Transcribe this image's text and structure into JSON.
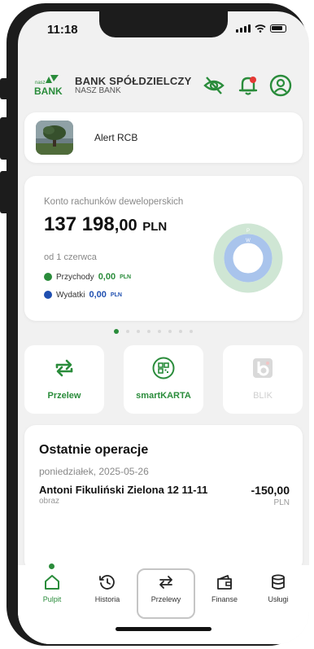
{
  "status": {
    "time": "11:18"
  },
  "header": {
    "bank_name": "BANK SPÓŁDZIELCZY",
    "bank_sub": "NASZ BANK",
    "logo_top": "nasz",
    "logo_bottom": "BANK"
  },
  "alert": {
    "label": "Alert RCB"
  },
  "account": {
    "name": "Konto rachunków deweloperskich",
    "amount_int": "137 198",
    "amount_dec": ",00",
    "currency": "PLN",
    "since": "od 1 czerwca",
    "income_label": "Przychody",
    "income_value": "0,00",
    "expense_label": "Wydatki",
    "expense_value": "0,00",
    "small_currency": "PLN",
    "chart_labels": {
      "outer": "P",
      "inner": "W"
    },
    "colors": {
      "income": "#2a8c3b",
      "expense": "#1f4fb0",
      "ring_outer": "#cfe6d4",
      "ring_inner": "#a9c4ec"
    }
  },
  "pager": {
    "count": 8,
    "active": 0
  },
  "quick_actions": [
    {
      "label": "Przelew",
      "icon": "transfer-icon",
      "enabled": true
    },
    {
      "label": "smartKARTA",
      "icon": "qr-card-icon",
      "enabled": true
    },
    {
      "label": "BLIK",
      "icon": "blik-icon",
      "enabled": false
    }
  ],
  "operations": {
    "title": "Ostatnie operacje",
    "date": "poniedziałek, 2025-05-26",
    "items": [
      {
        "name": "Antoni Fikuliński  Zielona 12 11-11",
        "desc": "obraz",
        "amount": "-150,00",
        "currency": "PLN"
      }
    ]
  },
  "tabs": [
    {
      "label": "Pulpit",
      "icon": "home-icon",
      "active": true
    },
    {
      "label": "Historia",
      "icon": "history-icon",
      "active": false
    },
    {
      "label": "Przelewy",
      "icon": "transfer-icon",
      "active": false
    },
    {
      "label": "Finanse",
      "icon": "wallet-icon",
      "active": false
    },
    {
      "label": "Usługi",
      "icon": "database-icon",
      "active": false
    }
  ],
  "theme": {
    "accent": "#2a8c3b",
    "background": "#f1f1f1",
    "alert_red": "#e53935"
  }
}
